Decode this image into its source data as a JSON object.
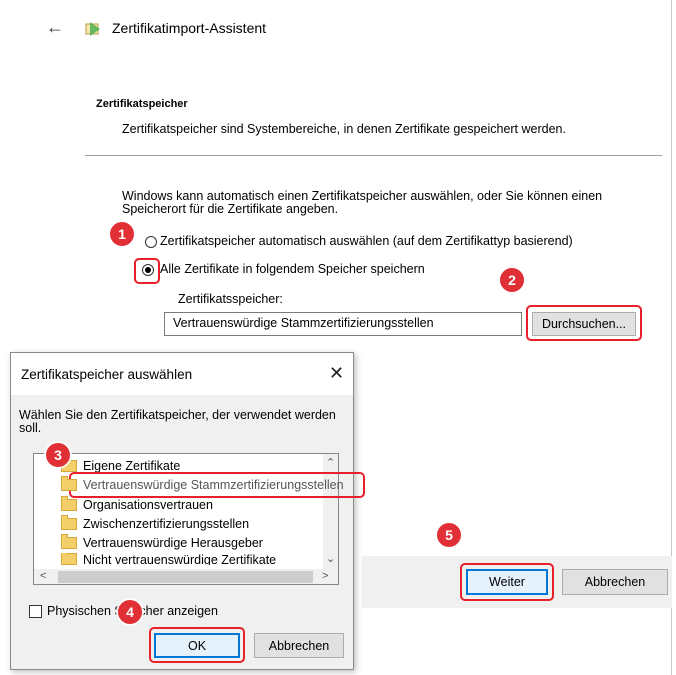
{
  "wizard": {
    "title": "Zertifikatimport-Assistent",
    "section_title": "Zertifikatspeicher",
    "section_desc": "Zertifikatspeicher sind Systembereiche, in denen Zertifikate gespeichert werden.",
    "paragraph": "Windows kann automatisch einen Zertifikatspeicher auswählen, oder Sie können einen Speicherort für die Zertifikate angeben.",
    "radio_auto_label": "Zertifikatspeicher automatisch auswählen (auf dem Zertifikattyp basierend)",
    "radio_manual_label": "Alle Zertifikate in folgendem Speicher speichern",
    "store_label": "Zertifikatsspeicher:",
    "store_value": "Vertrauenswürdige Stammzertifizierungsstellen",
    "browse_label": "Durchsuchen...",
    "next_label": "Weiter",
    "cancel_label": "Abbrechen"
  },
  "dialog": {
    "title": "Zertifikatspeicher auswählen",
    "close_glyph": "✕",
    "instruction": "Wählen Sie den Zertifikatspeicher, der verwendet werden soll.",
    "tree_items": [
      "Eigene Zertifikate",
      "Vertrauenswürdige Stammzertifizierungsstellen",
      "Organisationsvertrauen",
      "Zwischenzertifizierungsstellen",
      "Vertrauenswürdige Herausgeber",
      "Nicht vertrauenswürdige Zertifikate"
    ],
    "show_physical_label": "Physischen Speicher anzeigen",
    "ok_label": "OK",
    "cancel_label": "Abbrechen"
  },
  "badges": [
    "1",
    "2",
    "3",
    "4",
    "5"
  ],
  "colors": {
    "accent": "#0078d7",
    "highlight": "#e8202a",
    "badge": "#e03035"
  }
}
